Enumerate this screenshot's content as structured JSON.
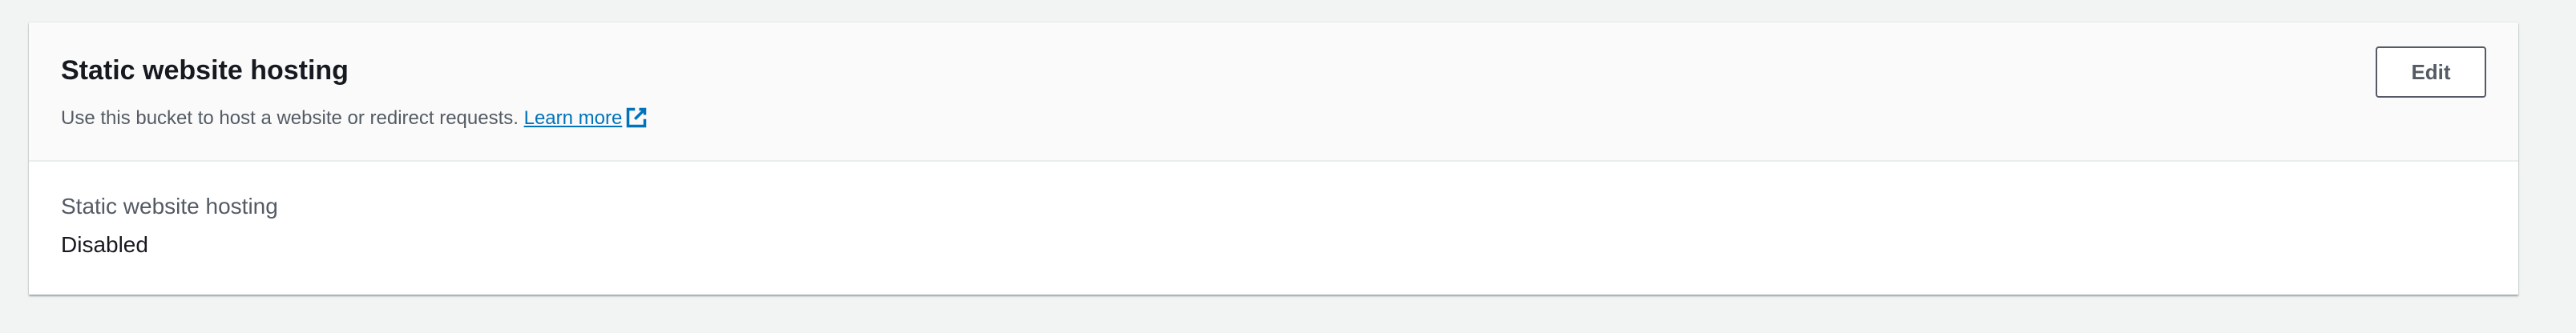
{
  "panel": {
    "title": "Static website hosting",
    "description": "Use this bucket to host a website or redirect requests.",
    "learn_more_label": "Learn more",
    "learn_more_icon": "external-link-icon",
    "edit_label": "Edit"
  },
  "fields": [
    {
      "label": "Static website hosting",
      "value": "Disabled"
    }
  ],
  "colors": {
    "page_background": "#f2f3f3",
    "header_background": "#fafafa",
    "link": "#0073bb",
    "title_text": "#16191f",
    "secondary_text": "#545b64"
  }
}
